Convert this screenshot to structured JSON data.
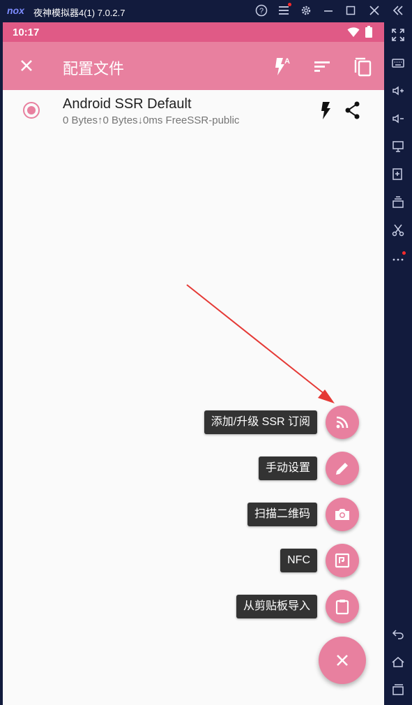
{
  "window": {
    "logo": "nox",
    "title": "夜神模拟器4(1) 7.0.2.7",
    "controls": [
      "help-icon",
      "menu-icon",
      "settings-icon",
      "minimize-icon",
      "maximize-icon",
      "close-icon",
      "collapse-icon"
    ]
  },
  "status_bar": {
    "time": "10:17"
  },
  "app_bar": {
    "title": "配置文件",
    "actions": [
      "close-icon",
      "auto-flash-icon",
      "sort-icon",
      "copy-icon"
    ]
  },
  "profile": {
    "name": "Android SSR Default",
    "subtitle": "0 Bytes↑0 Bytes↓0ms FreeSSR-public",
    "selected": true
  },
  "fab_menu": [
    {
      "label": "添加/升级 SSR 订阅",
      "icon": "rss-icon"
    },
    {
      "label": "手动设置",
      "icon": "pencil-icon"
    },
    {
      "label": "扫描二维码",
      "icon": "camera-icon"
    },
    {
      "label": "NFC",
      "icon": "nfc-icon"
    },
    {
      "label": "从剪贴板导入",
      "icon": "clipboard-icon"
    }
  ],
  "colors": {
    "accent": "#e8809f",
    "status": "#e05a86",
    "emulator_bg": "#121b3d",
    "arrow": "#e53935"
  }
}
